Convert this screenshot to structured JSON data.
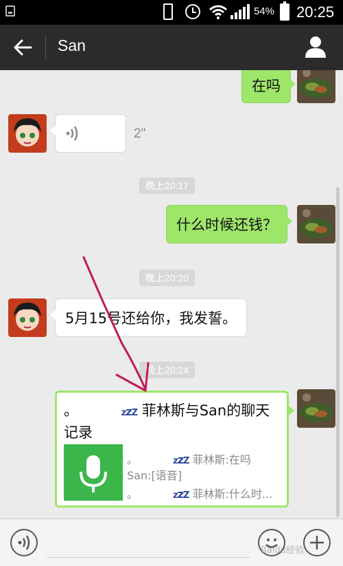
{
  "status_bar": {
    "battery_percent": "54%",
    "time": "20:25"
  },
  "header": {
    "title": "San"
  },
  "messages": {
    "m1": {
      "text": "在吗"
    },
    "m2": {
      "duration": "2\""
    },
    "t1": {
      "text": "晚上20:17"
    },
    "m3": {
      "text": "什么时候还钱？"
    },
    "t2": {
      "text": "晚上20:20"
    },
    "m4": {
      "text": "5月15号还给你，我发誓。"
    },
    "t3": {
      "text": "晚上20:24"
    },
    "record": {
      "title_prefix": "。",
      "title_main": "菲林斯与San的聊天记录",
      "line1_prefix": "。",
      "line1": "菲林斯:在吗",
      "line2": "San:[语音]",
      "line3_prefix": "。",
      "line3": "菲林斯:什么时..."
    }
  },
  "colors": {
    "accent_green": "#9ee66a",
    "record_thumb": "#3bb64a",
    "header_bg": "#2b2b2b",
    "annotation": "#c2185b"
  },
  "icons": {
    "back": "back-arrow-icon",
    "profile": "person-icon",
    "voice": "voice-wave-icon",
    "mic": "microphone-icon",
    "emoji": "smiley-icon",
    "plus": "plus-icon"
  },
  "watermark": "Baidu经验"
}
